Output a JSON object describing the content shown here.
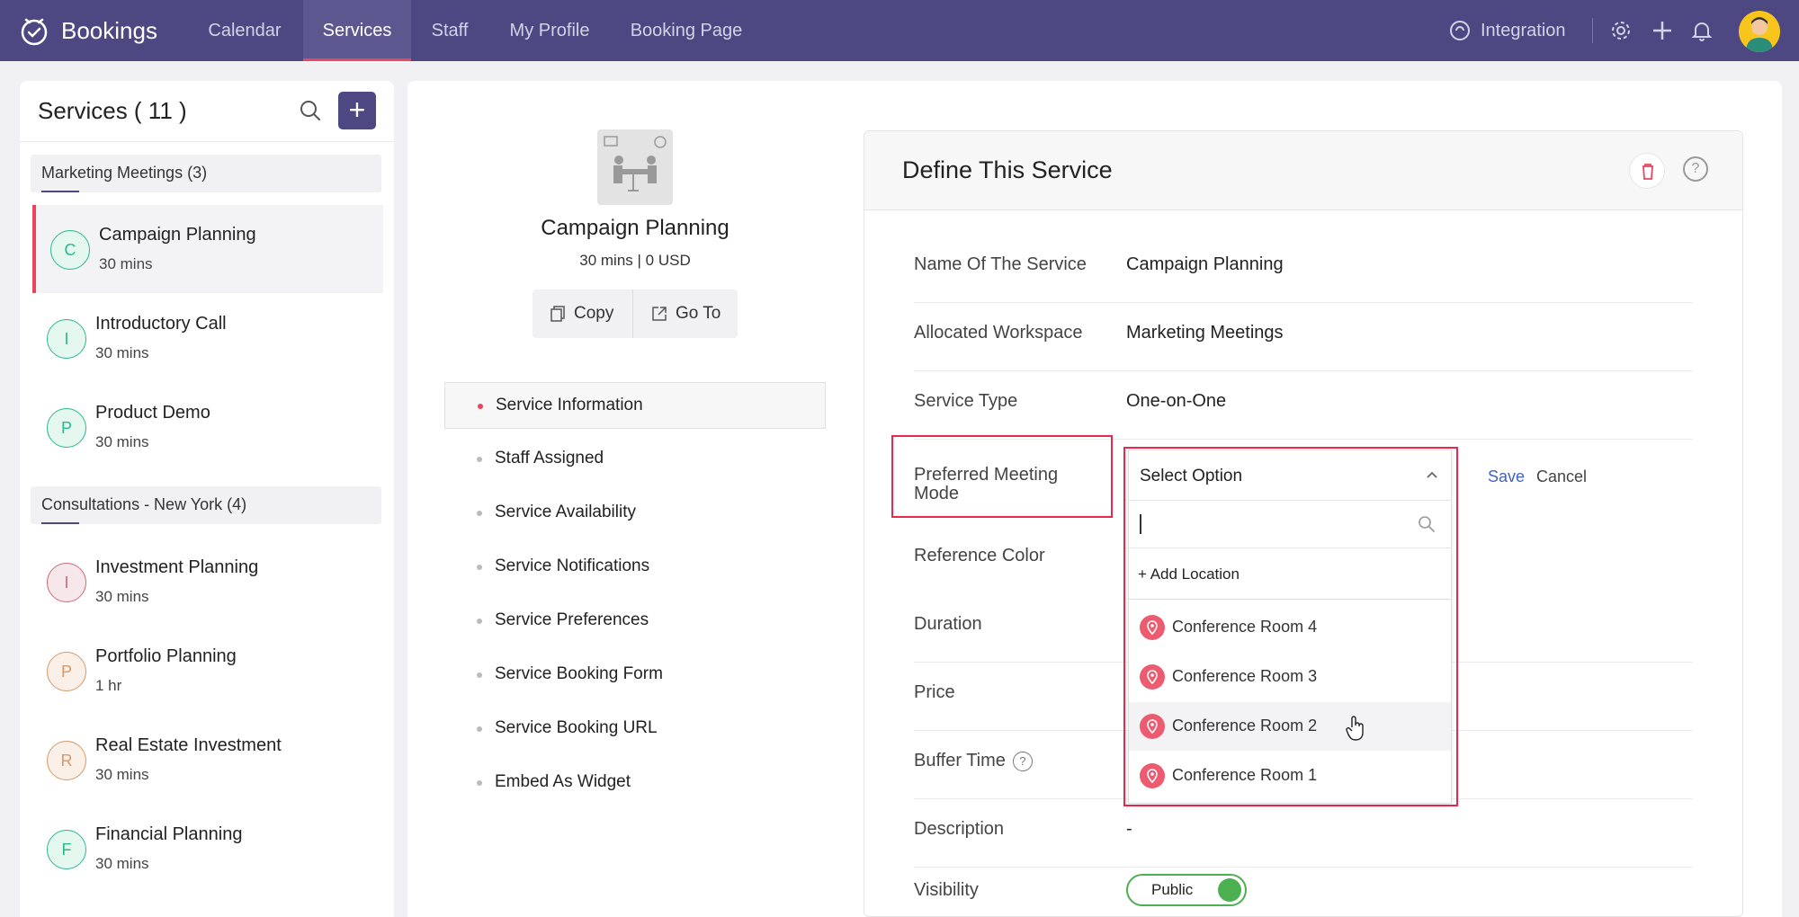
{
  "app": {
    "name": "Bookings"
  },
  "nav": {
    "tabs": [
      "Calendar",
      "Services",
      "Staff",
      "My Profile",
      "Booking Page"
    ],
    "active": "Services",
    "integration_label": "Integration"
  },
  "sidebar": {
    "title": "Services ( 11 )",
    "groups": [
      {
        "name": "Marketing Meetings (3)"
      },
      {
        "name": "Consultations - New York (4)"
      }
    ],
    "items": [
      {
        "initial": "C",
        "name": "Campaign Planning",
        "duration": "30 mins",
        "color": "#2bb78d",
        "bg": "#e4f8f0"
      },
      {
        "initial": "I",
        "name": "Introductory Call",
        "duration": "30 mins",
        "color": "#2bb78d",
        "bg": "#e4f8f0"
      },
      {
        "initial": "P",
        "name": "Product Demo",
        "duration": "30 mins",
        "color": "#2bb78d",
        "bg": "#e4f8f0"
      },
      {
        "initial": "I",
        "name": "Investment Planning",
        "duration": "30 mins",
        "color": "#c96a7a",
        "bg": "#f6e8ea"
      },
      {
        "initial": "P",
        "name": "Portfolio Planning",
        "duration": "1 hr",
        "color": "#d49a6a",
        "bg": "#fbf0e8"
      },
      {
        "initial": "R",
        "name": "Real Estate Investment",
        "duration": "30 mins",
        "color": "#d49a6a",
        "bg": "#fbf0e8"
      },
      {
        "initial": "F",
        "name": "Financial Planning",
        "duration": "30 mins",
        "color": "#2bb78d",
        "bg": "#e4f8f0"
      }
    ]
  },
  "service": {
    "title": "Campaign Planning",
    "subtitle": "30 mins | 0 USD",
    "copy_label": "Copy",
    "goto_label": "Go To"
  },
  "menu": [
    "Service Information",
    "Staff Assigned",
    "Service Availability",
    "Service Notifications",
    "Service Preferences",
    "Service Booking Form",
    "Service Booking URL",
    "Embed As Widget"
  ],
  "define": {
    "title": "Define This Service",
    "fields": [
      {
        "label": "Name Of The Service",
        "value": "Campaign Planning"
      },
      {
        "label": "Allocated Workspace",
        "value": "Marketing Meetings"
      },
      {
        "label": "Service Type",
        "value": "One-on-One"
      }
    ],
    "preferred_label": "Preferred Meeting Mode",
    "reference_color_label": "Reference Color",
    "duration_label": "Duration",
    "price_label": "Price",
    "buffer_label": "Buffer Time",
    "buffer_help": "?",
    "description_label": "Description",
    "description_value": "-",
    "visibility_label": "Visibility",
    "visibility_value": "Public",
    "save_label": "Save",
    "cancel_label": "Cancel"
  },
  "dropdown": {
    "selected": "Select Option",
    "add_location": "+ Add Location",
    "options": [
      "Conference Room 4",
      "Conference Room 3",
      "Conference Room 2",
      "Conference Room 1"
    ],
    "hovered": "Conference Room 2"
  },
  "colors": {
    "brand": "#4d4882",
    "accent": "#e8455f",
    "highlight": "#e8294f",
    "toggle_on": "#4caf50",
    "link": "#3f63c4"
  }
}
